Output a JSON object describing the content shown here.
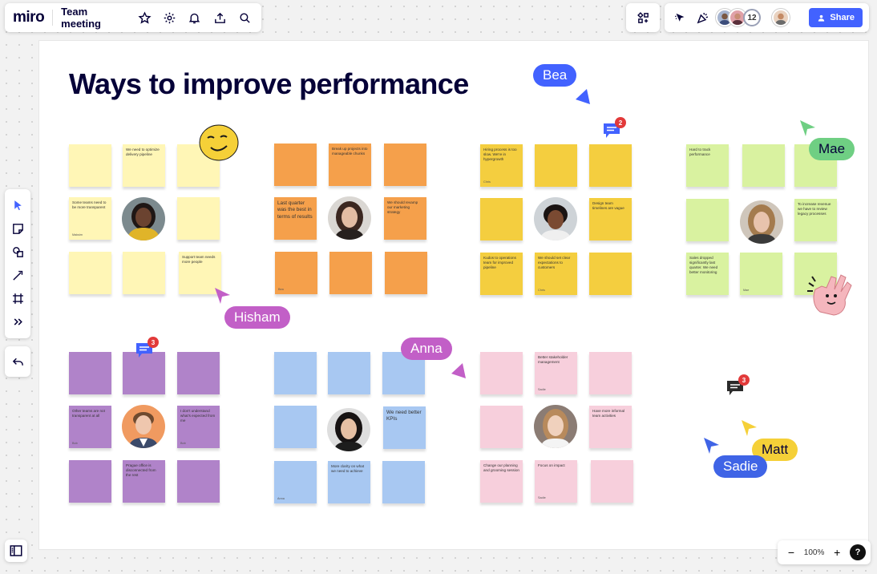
{
  "app": {
    "logo": "miro",
    "board_title": "Team meeting"
  },
  "toolbar": {
    "share_label": "Share",
    "collaborator_count": "12"
  },
  "zoom": {
    "level": "100%",
    "minus": "−",
    "plus": "+",
    "help": "?"
  },
  "board": {
    "title": "Ways to improve performance"
  },
  "notes": {
    "y1": "We need to optimize delivery pipeline",
    "y2": "Some teams need to be more transparent",
    "y2_author": "Maksim",
    "y3": "Support team needs more people",
    "o1": "Break up projects into manageable chunks",
    "o2": "Last quarter was the best in terms of results",
    "o3": "We should revamp our marketing strategy",
    "o4_author": "Bea",
    "g1": "Hiring process is too slow. We're in hypergrowth",
    "g1_author": "Chris",
    "g2": "Design team timelines are vague",
    "g3": "Kudos to operations team for improved pipeline",
    "g4": "We should set clear expectations to customers",
    "g4_author": "Chris",
    "gr1": "Hard to track performance",
    "gr2": "To increase revenue we have to review legacy processes",
    "gr3": "Sales dropped significantly last quarter. We need better monitoring",
    "gr4_author": "Mae",
    "p1": "Other teams are not transparent at all",
    "p1_author": "Bob",
    "p2": "I don't understand what's expected from me",
    "p2_author": "Bob",
    "p3": "Prague office is disconnected from the rest",
    "b1": "We need better KPIs",
    "b2": "More clarity on what we need to achieve",
    "b3_author": "Anna",
    "pk1": "Better stakeholder management",
    "pk1_author": "Sadie",
    "pk2": "Have more informal team activities",
    "pk3": "Change our planning and grooming session",
    "pk4": "Focus on impact",
    "pk4_author": "Sadie"
  },
  "cursors": {
    "bea": "Bea",
    "mae": "Mae",
    "hisham": "Hisham",
    "anna": "Anna",
    "matt": "Matt",
    "sadie": "Sadie"
  },
  "comments": {
    "c1": "2",
    "c2": "3",
    "c3": "3"
  },
  "colors": {
    "yellow": "#fff6b6",
    "orange": "#f5a04b",
    "gold": "#f4ce3f",
    "green": "#d9f2a0",
    "purple": "#b083c9",
    "blue": "#a8c8f2",
    "pink": "#f7cfdc",
    "bea": "#4262ff",
    "mae": "#6fcf83",
    "hisham": "#c25fc7",
    "anna": "#c25fc7",
    "matt": "#f5d038",
    "sadie": "#3f64e6",
    "share": "#4262ff"
  }
}
